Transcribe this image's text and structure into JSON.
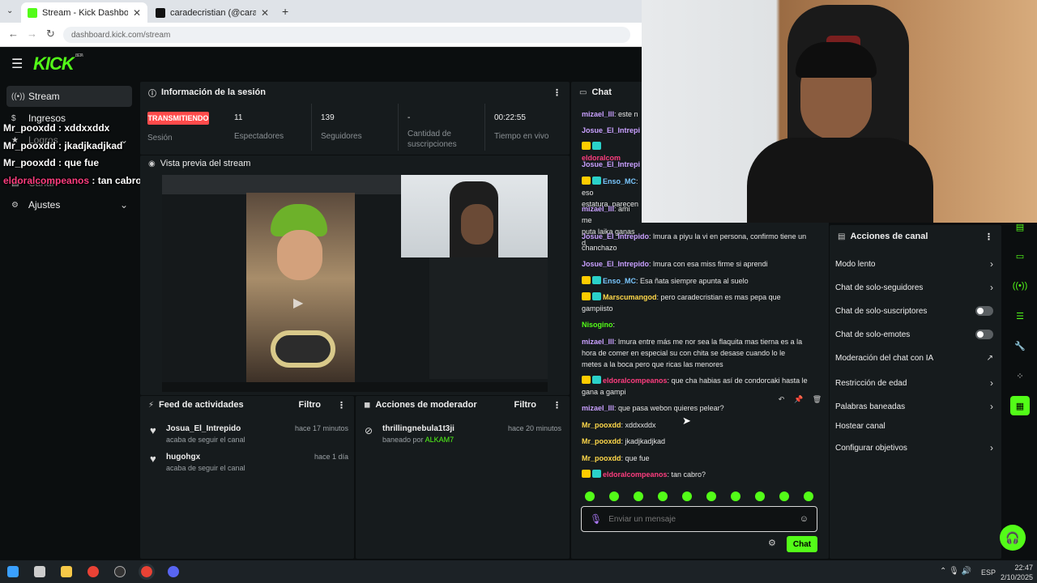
{
  "browser": {
    "tabs": [
      {
        "title": "Stream - Kick Dashboard",
        "close": "✕"
      },
      {
        "title": "caradecristian (@caradecri",
        "close": "✕"
      }
    ],
    "new_tab": "+",
    "url": "dashboard.kick.com/stream"
  },
  "app": {
    "logo": "KICK",
    "logo_sup": "BETA"
  },
  "sidebar": {
    "items": [
      {
        "label": "Stream",
        "icon": "((•))"
      },
      {
        "label": "Ingresos",
        "icon": "$"
      },
      {
        "label": "Logros",
        "icon": "★"
      },
      {
        "label": "Canal",
        "icon": "▤"
      },
      {
        "label": "Ajustes",
        "icon": "⚙"
      }
    ]
  },
  "overlay_chat": [
    {
      "user": "Mr_pooxdd",
      "text": " : xddxxddx",
      "color": "#ffffff"
    },
    {
      "user": "Mr_pooxdd",
      "text": " : jkadjkadjkad",
      "color": "#ffffff"
    },
    {
      "user": "Mr_pooxdd",
      "text": " : que fue",
      "color": "#ffffff"
    },
    {
      "user": "eldoralcompeanos",
      "text": " : tan cabro?",
      "color": "#ff3d7f"
    }
  ],
  "session": {
    "header": "Información de la sesión",
    "status": "TRANSMITIENDO",
    "status_label": "Sesión",
    "viewers": "11",
    "viewers_label": "Espectadores",
    "followers": "139",
    "followers_label": "Seguidores",
    "subs": "-",
    "subs_label": "Cantidad de suscripciones",
    "uptime": "00:22:55",
    "uptime_label": "Tiempo en vivo"
  },
  "preview": {
    "header": "Vista previa del stream"
  },
  "activity": {
    "header": "Feed de actividades",
    "filter": "Filtro",
    "items": [
      {
        "name": "Josua_El_Intrepido",
        "sub": "acaba de seguir el canal",
        "time": "hace 17 minutos"
      },
      {
        "name": "hugohgx",
        "sub": "acaba de seguir el canal",
        "time": "hace 1 día"
      }
    ]
  },
  "modactions": {
    "header": "Acciones de moderador",
    "filter": "Filtro",
    "items": [
      {
        "name": "thrillingnebula1t3ji",
        "sub_pre": "baneado por ",
        "by": "ALKAM7",
        "time": "hace 20 minutos"
      }
    ]
  },
  "chat": {
    "header": "Chat",
    "placeholder": "Enviar un mensaje",
    "send": "Chat",
    "messages": [
      {
        "user": "mizael_lll",
        "color": "#c9a0ff",
        "text": ": este n"
      },
      {
        "user": "Josue_El_Intrepido",
        "color": "#c9a0ff",
        "text": ""
      },
      {
        "user": "eldoralcom",
        "color": "#ff3d7f",
        "text": "",
        "badges": true
      },
      {
        "user": "Josue_El_Intrepido",
        "color": "#c9a0ff",
        "text": ""
      },
      {
        "user": "Enso_MC",
        "color": "#7ac7ff",
        "text": ": eso",
        "cont": "estatura, parecen",
        "badges": true
      },
      {
        "user": "mizael_lll",
        "color": "#c9a0ff",
        "text": ": ami me",
        "cont": "puta laika ganas d"
      },
      {
        "user": "Josue_El_Intrepido",
        "color": "#c9a0ff",
        "text": ": lmura a piyu la vi en persona, confirmo tiene un",
        "cont": "chanchazo"
      },
      {
        "user": "Josue_El_Intrepido",
        "color": "#c9a0ff",
        "text": ": lmura con esa miss firme si aprendi"
      },
      {
        "user": "Enso_MC",
        "color": "#7ac7ff",
        "text": ": Esa ñata siempre apunta al suelo",
        "badges": true
      },
      {
        "user": "Marscumangod",
        "color": "#ffd84a",
        "text": ": pero caradecristian es mas pepa que",
        "cont": "gampiisto",
        "badges": true
      },
      {
        "user": "Nisogino",
        "color": "#53fc18",
        "text": ":"
      },
      {
        "user": "mizael_lll",
        "color": "#c9a0ff",
        "text": ": lmura entre más me nor sea la flaquita mas tierna es a la",
        "cont": "hora de comer en especial su con chita se desase cuando lo le",
        "cont2": "metes a la boca pero que ricas las menores"
      },
      {
        "user": "eldoralcompeanos",
        "color": "#ff3d7f",
        "text": ": que cha habias así de condorcaki hasta le",
        "cont": "gana a gampi",
        "badges": true
      },
      {
        "user": "mizael_lll",
        "color": "#c9a0ff",
        "text": ": que pasa webon quieres pelear?"
      },
      {
        "user": "Mr_pooxdd",
        "color": "#ffd84a",
        "text": ": xddxxddx"
      },
      {
        "user": "Mr_pooxdd",
        "color": "#ffd84a",
        "text": ": jkadjkadjkad"
      },
      {
        "user": "Mr_pooxdd",
        "color": "#ffd84a",
        "text": ": que fue"
      },
      {
        "user": "eldoralcompeanos",
        "color": "#ff3d7f",
        "text": ": tan cabro?",
        "badges": true
      }
    ]
  },
  "channel_actions": {
    "header": "Acciones de canal",
    "items": [
      {
        "label": "Modo lento",
        "ctrl": "chevron"
      },
      {
        "label": "Chat de solo-seguidores",
        "ctrl": "chevron"
      },
      {
        "label": "Chat de solo-suscriptores",
        "ctrl": "toggle"
      },
      {
        "label": "Chat de solo-emotes",
        "ctrl": "toggle"
      },
      {
        "label": "Moderación del chat con IA",
        "ctrl": "external"
      },
      {
        "label": "Restricción de edad",
        "ctrl": "chevron"
      },
      {
        "label": "Palabras baneadas",
        "ctrl": "chevron"
      },
      {
        "label": "Hostear canal",
        "ctrl": "none"
      },
      {
        "label": "Configurar objetivos",
        "ctrl": "chevron"
      }
    ]
  },
  "taskbar": {
    "lang": "ESP",
    "time": "22:47",
    "date": "2/10/2025"
  },
  "colors": {
    "accent": "#53fc18",
    "live": "#ff4b4b",
    "panel": "#161b1d"
  }
}
